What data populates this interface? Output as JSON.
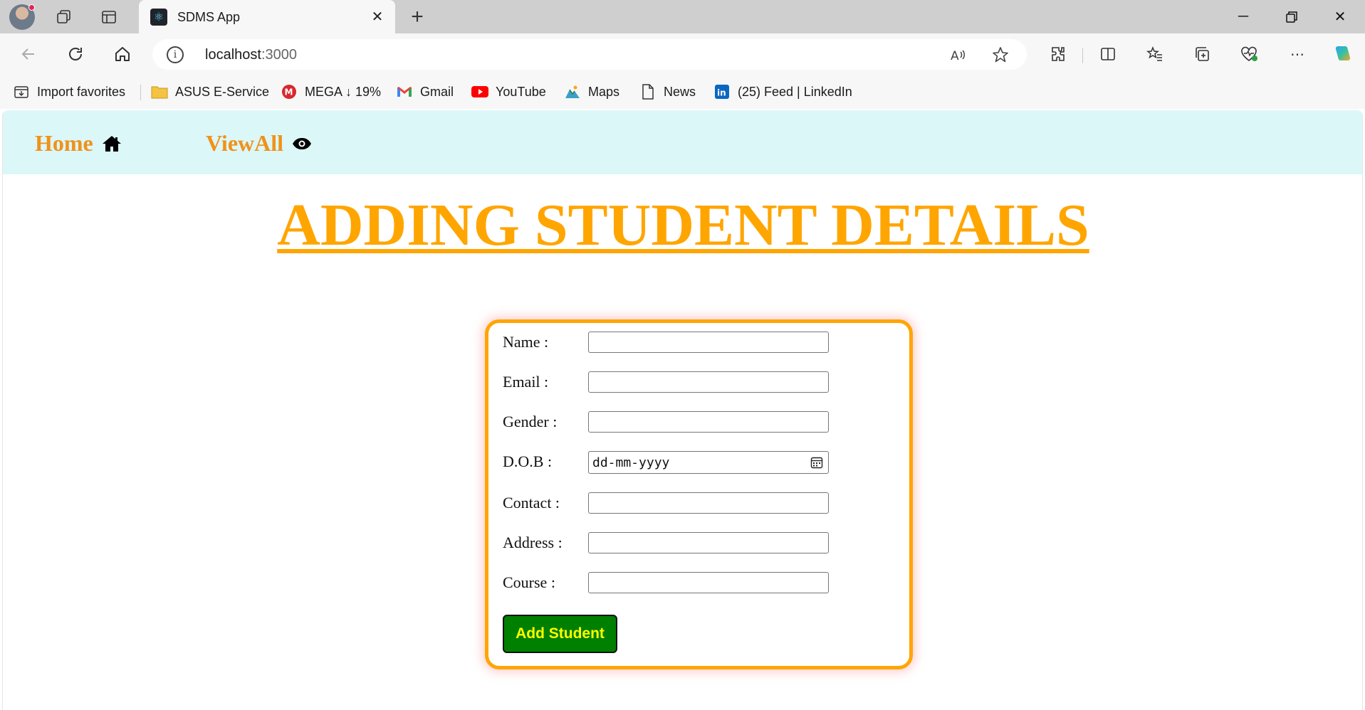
{
  "browser": {
    "tab_title": "SDMS App",
    "url_host": "localhost",
    "url_port": ":3000",
    "favorites": [
      {
        "label": "Import favorites"
      },
      {
        "label": "ASUS E-Service"
      },
      {
        "label": "MEGA ↓ 19%"
      },
      {
        "label": "Gmail"
      },
      {
        "label": "YouTube"
      },
      {
        "label": "Maps"
      },
      {
        "label": "News"
      },
      {
        "label": "(25) Feed | LinkedIn"
      }
    ]
  },
  "nav": {
    "home_label": "Home",
    "viewall_label": "ViewAll"
  },
  "page": {
    "title": "ADDING STUDENT DETAILS"
  },
  "form": {
    "fields": [
      {
        "label": "Name :",
        "value": ""
      },
      {
        "label": "Email :",
        "value": ""
      },
      {
        "label": "Gender :",
        "value": ""
      },
      {
        "label": "D.O.B :",
        "placeholder": "dd-mm-yyyy"
      },
      {
        "label": "Contact :",
        "value": ""
      },
      {
        "label": "Address :",
        "value": ""
      },
      {
        "label": "Course :",
        "value": ""
      }
    ],
    "submit_label": "Add Student"
  },
  "colors": {
    "accent": "#ffa500",
    "nav_bg": "#dcf7f8",
    "nav_link": "#f0921a",
    "button_bg": "#008000",
    "button_text": "#ffff00"
  }
}
